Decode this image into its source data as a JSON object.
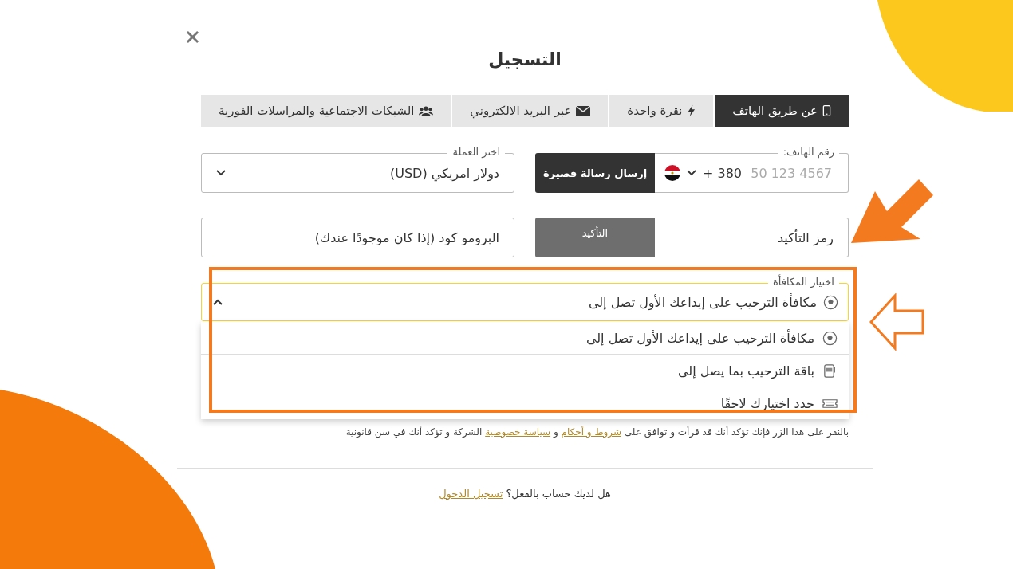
{
  "title": "التسجيل",
  "tabs": [
    {
      "label": "عن طريق الهاتف",
      "kind": "phone",
      "selected": true
    },
    {
      "label": "نقرة واحدة",
      "kind": "bolt",
      "selected": false
    },
    {
      "label": "عبر البريد الالكتروني",
      "kind": "mail",
      "selected": false
    },
    {
      "label": "الشبكات الاجتماعية والمراسلات الفورية",
      "kind": "people",
      "selected": false
    }
  ],
  "phone": {
    "label": "رقم الهاتف:",
    "placeholder": "50 123 4567",
    "code": "+ 380",
    "button": "إرسال رسالة قصيرة"
  },
  "currency": {
    "label": "اختر العملة",
    "value": "دولار امريكي (USD)"
  },
  "confirm": {
    "placeholder": "رمز التأكيد",
    "button": "التأكيد",
    "disabled": true
  },
  "promo": {
    "placeholder": "البرومو كود (إذا كان موجودًا عندك)"
  },
  "bonus": {
    "label": "اختيار المكافأة",
    "value": "مكافأة الترحيب على إيداعك الأول تصل إلى",
    "expanded": true,
    "options": [
      {
        "label": "مكافأة الترحيب على إيداعك الأول تصل إلى",
        "kind": "ball"
      },
      {
        "label": "باقة الترحيب بما يصل إلى",
        "kind": "slot"
      },
      {
        "label": "حدد اختيارك لاحقًا",
        "kind": "ticket"
      }
    ]
  },
  "terms": [
    {
      "text": "بالنقر على هذا الزر فإنك تؤكد أنك قد قرأت و توافق على ",
      "link": false
    },
    {
      "text": "شروط و أحكام",
      "link": true
    },
    {
      "text": " و ",
      "link": false
    },
    {
      "text": "سياسة خصوصية",
      "link": true
    },
    {
      "text": " الشركة و تؤكد أنك في سن قانونية",
      "link": false
    }
  ],
  "login": {
    "question": "هل لديك حساب بالفعل؟",
    "link": "تسجيل الدخول"
  }
}
